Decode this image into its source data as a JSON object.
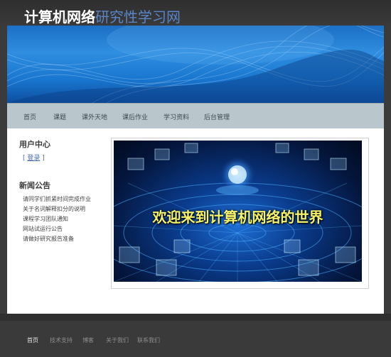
{
  "header": {
    "title_main": "计算机网络",
    "title_sub": "研究性学习网"
  },
  "nav": {
    "items": [
      {
        "label": "首页"
      },
      {
        "label": "课题"
      },
      {
        "label": "课外天地"
      },
      {
        "label": "课后作业"
      },
      {
        "label": "学习资料"
      },
      {
        "label": "后台管理"
      }
    ]
  },
  "sidebar": {
    "user_center_title": "用户中心",
    "login_open": "[ ",
    "login_label": "登录",
    "login_close": " ]",
    "news_title": "新闻公告",
    "news": [
      "请同学们抓紧时间完成作业",
      "关于名词解释扣分的说明",
      "课程学习团队通知",
      "网站试运行公告",
      "请做好研究报告准备"
    ]
  },
  "feature": {
    "caption": "欢迎来到计算机网络的世界"
  },
  "footer": {
    "items": [
      {
        "label": "首页"
      },
      {
        "label": "技术支持"
      },
      {
        "label": "博客"
      },
      {
        "label": "关于我们"
      },
      {
        "label": "联系我们"
      }
    ]
  }
}
